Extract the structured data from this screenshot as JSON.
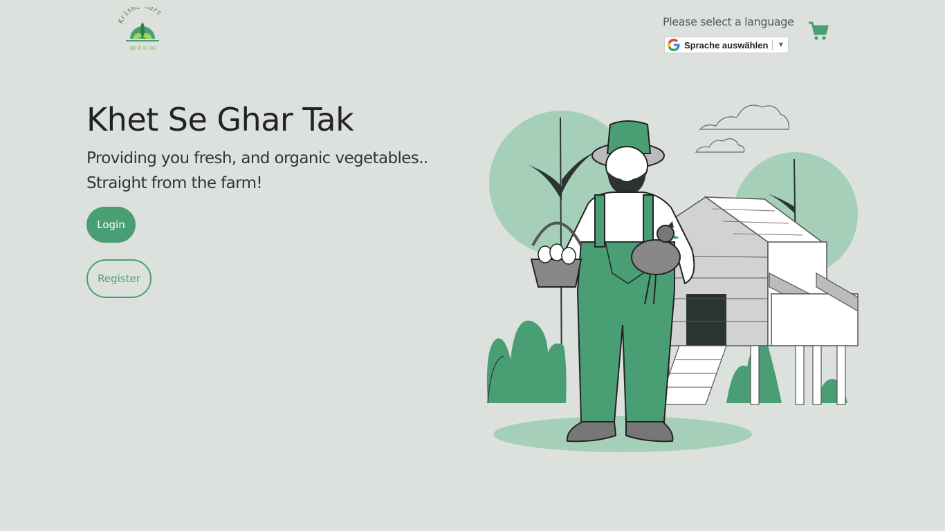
{
  "brand": {
    "logo_top_text": "Krishi Mart",
    "logo_bottom_text": "खेत से घर तक"
  },
  "language": {
    "prompt": "Please select a language",
    "select_label": "Sprache auswählen",
    "arrow": "▼"
  },
  "header": {
    "cart_icon": "shopping-cart-icon"
  },
  "hero": {
    "title": "Khet Se Ghar Tak",
    "subtitle_line1": "Providing you fresh, and organic vegetables..",
    "subtitle_line2": "Straight from the farm!",
    "login_label": "Login",
    "register_label": "Register"
  },
  "colors": {
    "background": "#dde1de",
    "accent_green": "#4a9e74",
    "light_green": "#a6cfb9"
  }
}
